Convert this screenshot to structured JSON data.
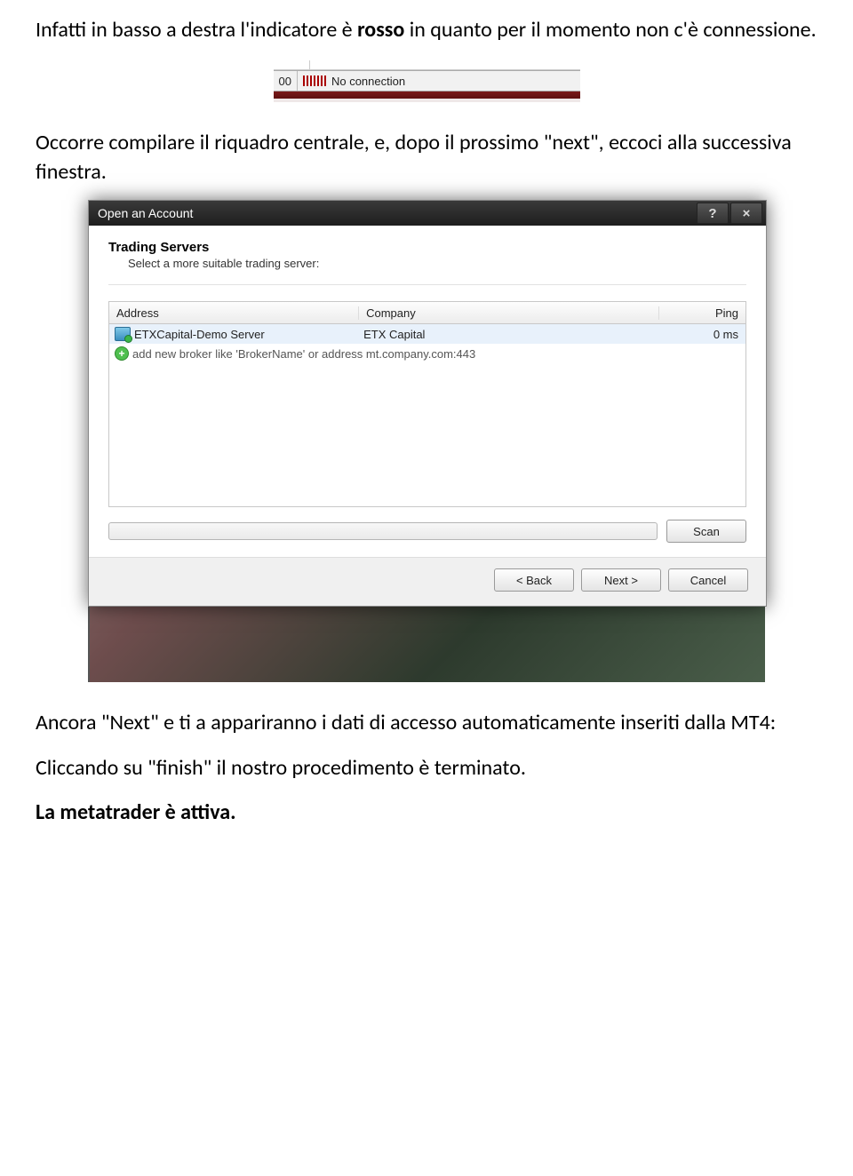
{
  "doc": {
    "p1_a": "Infatti in basso a destra l'indicatore è ",
    "p1_b": "rosso",
    "p1_c": " in quanto per il momento non c'è connessione.",
    "p2": "Occorre compilare il riquadro centrale, e, dopo il prossimo \"next\", eccoci alla successiva finestra.",
    "p3": "Ancora \"Next\" e ti a appariranno i dati di accesso automaticamente inseriti dalla MT4:",
    "p4": "Cliccando su \"finish\" il nostro procedimento è terminato.",
    "p5": "La metatrader è attiva."
  },
  "statusbar": {
    "value": "00",
    "text": "No connection"
  },
  "dialog": {
    "title": "Open an Account",
    "heading": "Trading Servers",
    "subheading": "Select a more suitable trading server:",
    "columns": {
      "address": "Address",
      "company": "Company",
      "ping": "Ping"
    },
    "rows": [
      {
        "address": "ETXCapital-Demo Server",
        "company": "ETX Capital",
        "ping": "0 ms"
      }
    ],
    "add_placeholder": "add new broker like 'BrokerName' or address mt.company.com:443",
    "buttons": {
      "scan": "Scan",
      "back": "< Back",
      "next": "Next >",
      "cancel": "Cancel"
    }
  }
}
